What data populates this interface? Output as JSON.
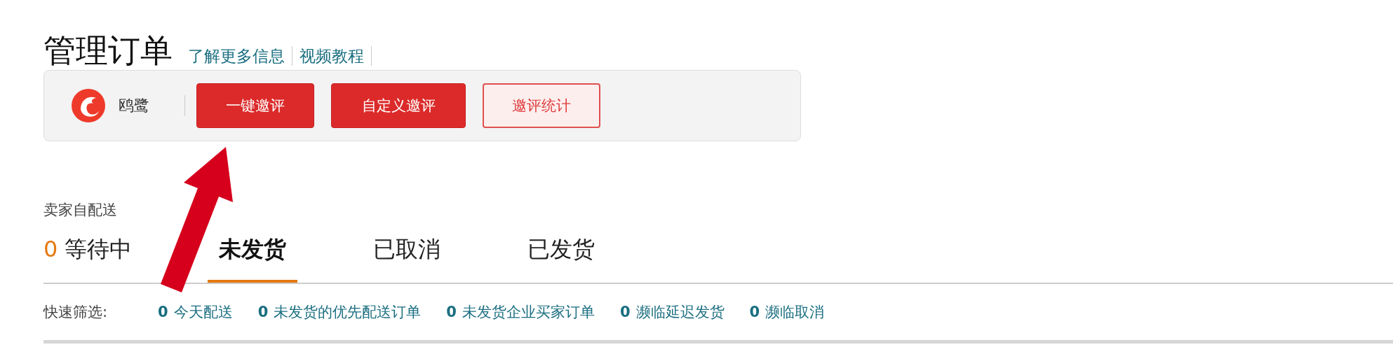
{
  "header": {
    "title": "管理订单",
    "links": [
      "了解更多信息",
      "视频教程"
    ]
  },
  "toolbar": {
    "brand": "鸥鹭",
    "buttons": [
      {
        "label": "一键邀评",
        "kind": "primary"
      },
      {
        "label": "自定义邀评",
        "kind": "primary"
      },
      {
        "label": "邀评统计",
        "kind": "outline"
      }
    ]
  },
  "section_label": "卖家自配送",
  "tabs": [
    {
      "count": "0",
      "label": "等待中",
      "selected": false
    },
    {
      "label": "未发货",
      "selected": true
    },
    {
      "label": "已取消",
      "selected": false
    },
    {
      "label": "已发货",
      "selected": false
    }
  ],
  "quick_filter": {
    "label": "快速筛选:",
    "items": [
      {
        "count": "0",
        "label": "今天配送"
      },
      {
        "count": "0",
        "label": "未发货的优先配送订单"
      },
      {
        "count": "0",
        "label": "未发货企业买家订单"
      },
      {
        "count": "0",
        "label": "濒临延迟发货"
      },
      {
        "count": "0",
        "label": "濒临取消"
      }
    ]
  }
}
